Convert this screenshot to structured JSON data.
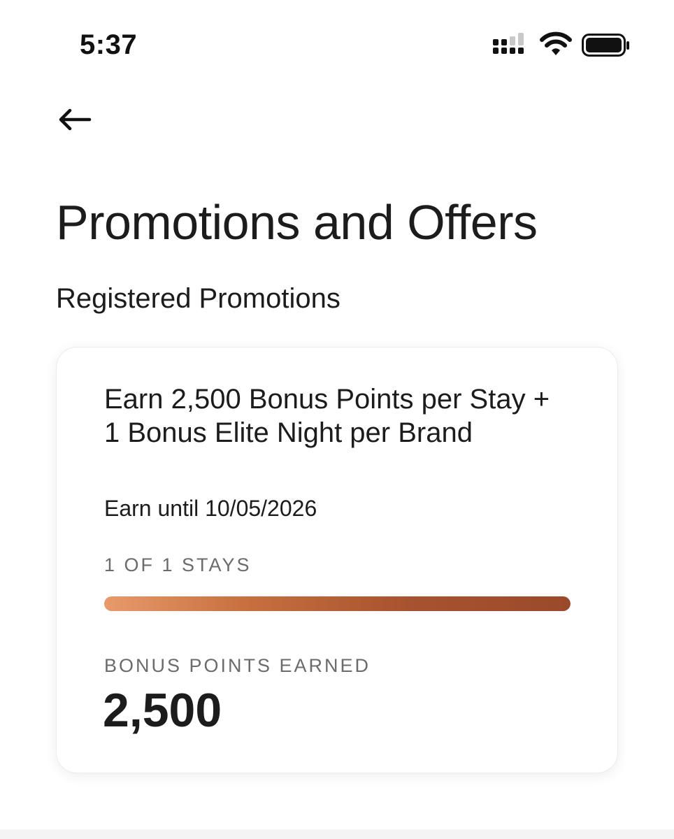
{
  "status_bar": {
    "time": "5:37"
  },
  "nav": {
    "back_icon": "arrow-left-icon"
  },
  "page": {
    "title": "Promotions and Offers",
    "section_title": "Registered Promotions"
  },
  "promotion": {
    "title": "Earn 2,500 Bonus Points per Stay + 1 Bonus Elite Night per Brand",
    "expiry": "Earn until 10/05/2026",
    "stays_progress_label": "1 OF 1 STAYS",
    "stays_completed": 1,
    "stays_required": 1,
    "progress_fraction": 1.0,
    "bonus_points_label": "BONUS POINTS EARNED",
    "bonus_points_value": "2,500"
  },
  "colors": {
    "progress_start": "#e89a6b",
    "progress_end": "#9a4a2a",
    "text_primary": "#1c1c1c",
    "text_muted": "#6b6b6b"
  }
}
